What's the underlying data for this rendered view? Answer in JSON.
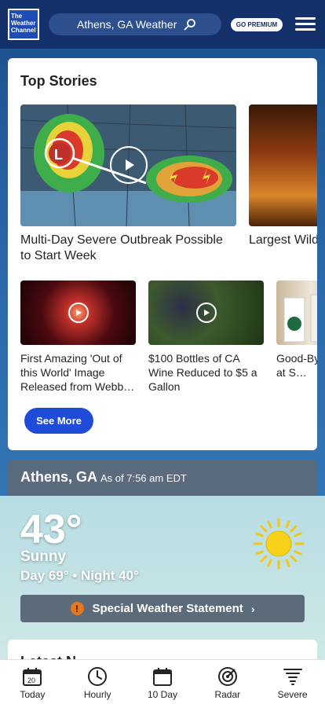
{
  "header": {
    "logo_text": "The Weather Channel",
    "search_text": "Athens, GA Weather",
    "premium_label": "GO PREMIUM"
  },
  "top_stories": {
    "title": "Top Stories",
    "featured": [
      {
        "caption": "Multi-Day Severe Outbreak Possible to Start Week",
        "has_video": true
      },
      {
        "caption": "Largest Wild… Continues to…",
        "has_video": false
      }
    ],
    "small": [
      {
        "caption": "First Amazing 'Out of this World' Image Released from Webb…",
        "has_video": true
      },
      {
        "caption": "$100 Bottles of CA Wine Reduced to $5 a Gallon",
        "has_video": true
      },
      {
        "caption": "Good-By… Cups at S…",
        "has_video": false
      }
    ],
    "see_more_label": "See More"
  },
  "today": {
    "location": "Athens, GA",
    "as_of": "As of 7:56 am EDT",
    "temperature": "43°",
    "condition": "Sunny",
    "day_night": "Day 69° • Night 40°",
    "alert_label": "Special Weather Statement",
    "icon": "sun-icon"
  },
  "latest": {
    "title": "Latest N…"
  },
  "bottom_nav": {
    "items": [
      {
        "label": "Today",
        "icon": "calendar-day-icon",
        "day": "20"
      },
      {
        "label": "Hourly",
        "icon": "clock-icon"
      },
      {
        "label": "10 Day",
        "icon": "calendar-icon"
      },
      {
        "label": "Radar",
        "icon": "radar-icon"
      },
      {
        "label": "Severe",
        "icon": "tornado-icon"
      }
    ]
  },
  "colors": {
    "header_bg": "#13306b",
    "accent_blue": "#1f4bd9",
    "alert_orange": "#e8771c"
  }
}
